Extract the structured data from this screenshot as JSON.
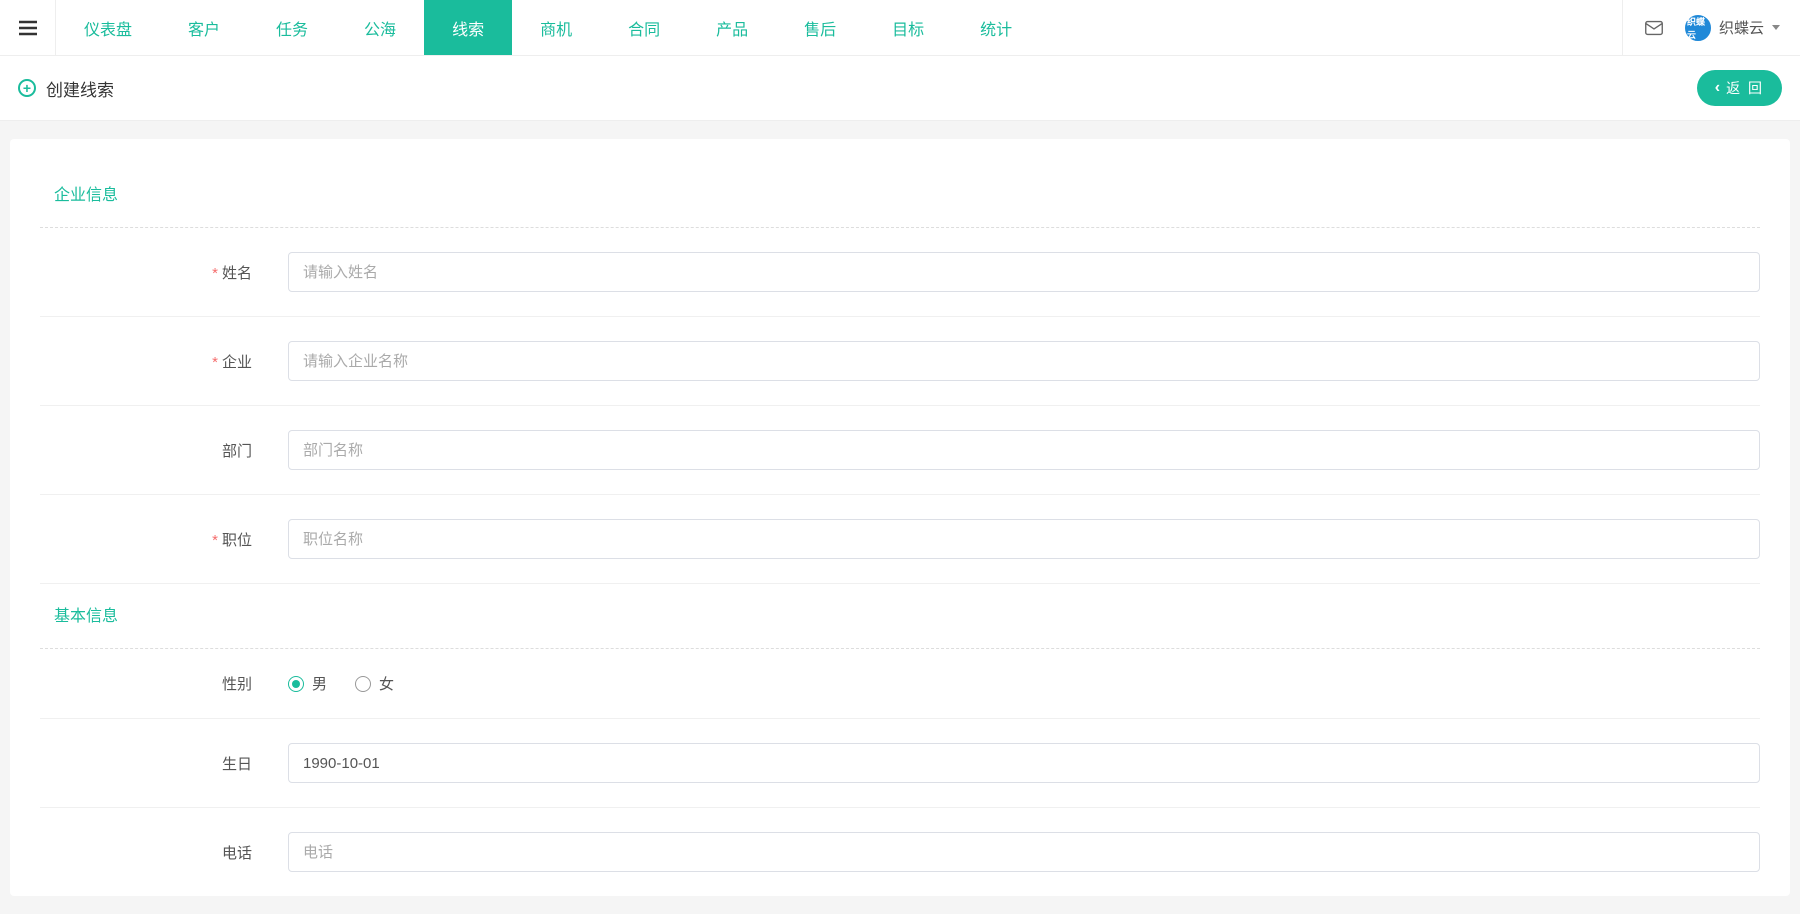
{
  "header": {
    "nav": [
      {
        "label": "仪表盘"
      },
      {
        "label": "客户"
      },
      {
        "label": "任务"
      },
      {
        "label": "公海"
      },
      {
        "label": "线索",
        "active": true
      },
      {
        "label": "商机"
      },
      {
        "label": "合同"
      },
      {
        "label": "产品"
      },
      {
        "label": "售后"
      },
      {
        "label": "目标"
      },
      {
        "label": "统计"
      }
    ],
    "user_name": "织蝶云",
    "avatar_text": "织蝶云"
  },
  "subheader": {
    "title": "创建线索",
    "back_label": "返 回"
  },
  "sections": {
    "enterprise": {
      "title": "企业信息",
      "fields": {
        "name": {
          "label": "姓名",
          "placeholder": "请输入姓名",
          "required": true
        },
        "company": {
          "label": "企业",
          "placeholder": "请输入企业名称",
          "required": true
        },
        "dept": {
          "label": "部门",
          "placeholder": "部门名称",
          "required": false
        },
        "position": {
          "label": "职位",
          "placeholder": "职位名称",
          "required": true
        }
      }
    },
    "basic": {
      "title": "基本信息",
      "fields": {
        "gender": {
          "label": "性别",
          "options": {
            "male": "男",
            "female": "女"
          },
          "selected": "male"
        },
        "birthday": {
          "label": "生日",
          "value": "1990-10-01"
        },
        "phone": {
          "label": "电话",
          "placeholder": "电话"
        }
      }
    }
  }
}
